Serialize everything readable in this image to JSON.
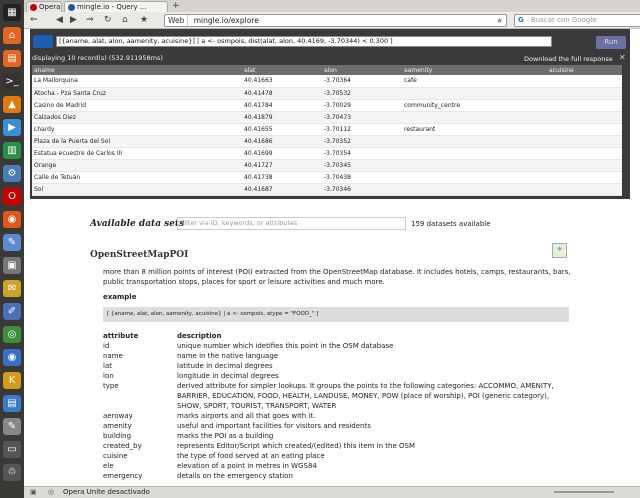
{
  "launcher": {
    "icons": [
      "dash-icon",
      "home-folder-icon",
      "files-icon",
      "terminal-icon",
      "vlc-icon",
      "software-center-icon",
      "libreoffice-icon",
      "settings-icon",
      "opera-icon",
      "firefox-icon",
      "text-editor-icon",
      "archive-icon",
      "sticky-notes-icon",
      "pencil-icon",
      "chrome-icon",
      "chromium-icon",
      "krusader-icon",
      "document-icon",
      "edit-icon",
      "disk-icon",
      "trash-icon"
    ]
  },
  "browser": {
    "tabs": [
      {
        "label": "Opera"
      },
      {
        "label": "mingle.io - Query ..."
      }
    ],
    "new_tab": "+",
    "nav": {
      "back": "⇐",
      "forward": "⇒",
      "reload": "↻",
      "home": "⌂",
      "bookmark": "★",
      "mode_label": "Web",
      "url": "mingle.io/explore",
      "search_placeholder": "Buscar con Google"
    }
  },
  "query": {
    "logo": "mingle",
    "input": "[{aname, alat, alon, aamenity, acuisine}] | a <- osmpois, dist(alat, alon, 40.4169, -3.70344) < 0.300 ]",
    "run_label": "Run",
    "status": "displaying 10 record(s) (532.911958ms)",
    "download_label": "Download the full response",
    "close": "✕",
    "columns": [
      "aname",
      "alat",
      "alon",
      "aamenity",
      "acuisine"
    ],
    "rows": [
      [
        "La Mallorquina",
        "40.41663",
        "-3.70364",
        "cafe",
        ""
      ],
      [
        "Atocha - Pza Santa Cruz",
        "40.41478",
        "-3.70532",
        "",
        ""
      ],
      [
        "Casino de Madrid",
        "40.41784",
        "-3.70029",
        "community_centre",
        ""
      ],
      [
        "Calzados Diez",
        "40.41879",
        "-3.70473",
        "",
        ""
      ],
      [
        "Lhardy",
        "40.41655",
        "-3.70112",
        "restaurant",
        ""
      ],
      [
        "Plaza de la Puerta del Sol",
        "40.41686",
        "-3.70352",
        "",
        ""
      ],
      [
        "Estatua ecuestre de Carlos III",
        "40.41699",
        "-3.70354",
        "",
        ""
      ],
      [
        "Orange",
        "40.41727",
        "-3.70345",
        "",
        ""
      ],
      [
        "Calle de Tetuán",
        "40.41738",
        "-3.70438",
        "",
        ""
      ],
      [
        "Sol",
        "40.41687",
        "-3.70346",
        "",
        ""
      ]
    ]
  },
  "datasets": {
    "title": "Available data sets",
    "filter_placeholder": "Filter via ID, keywords, or attributes",
    "count": "159 datasets available"
  },
  "osm": {
    "title": "OpenStreetMapPOI",
    "description": "more than 8 million points of interest (POI) extracted from the OpenStreetMap database. It includes hotels, camps, restaurants, bars, public transportation stops, places for sport or leisure activities and much more.",
    "example_label": "example",
    "example_code": "[ {aname, alat, alon, aamenity, acuisine} | a <- osmpois, atype = \"FOOD_\" ]",
    "attr_header": "attribute",
    "desc_header": "description",
    "attributes": [
      [
        "id",
        "unique number which idetifies this point in the OSM database"
      ],
      [
        "name",
        "name in the native language"
      ],
      [
        "lat",
        "latitude in decimal degrees"
      ],
      [
        "lon",
        "longitude in decimal degrees"
      ],
      [
        "type",
        "derived attribute for simpler lookups. It groups the points to the following categories: ACCOMMO, AMENITY, BARRIER, EDUCATION, FOOD, HEALTH, LANDUSE, MONEY, POW (place of worship), POI (generic category), SHOW, SPORT, TOURIST, TRANSPORT, WATER"
      ],
      [
        "aeroway",
        "marks airports and all that goes with it."
      ],
      [
        "amenity",
        "useful and important facilities for visitors and residents"
      ],
      [
        "building",
        "marks the POI as a building"
      ],
      [
        "created_by",
        "represents Editor/Script which created/(edited) this item in the OSM"
      ],
      [
        "cuisine",
        "the type of food served at an eating place"
      ],
      [
        "ele",
        "elevation of a point in metres in WGS84"
      ],
      [
        "emergency",
        "details on the emergency station"
      ]
    ]
  },
  "status_bar": {
    "text": "Opera Unite desactivado"
  }
}
